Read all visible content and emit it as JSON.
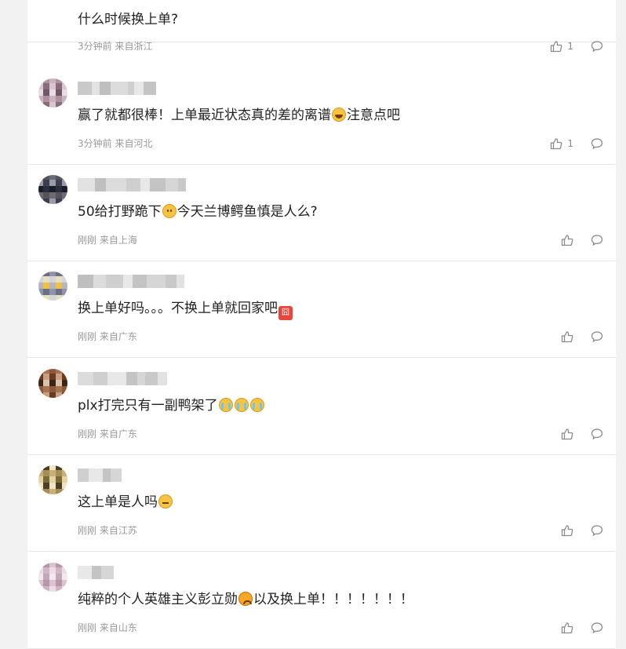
{
  "comments": [
    {
      "text": "什么时候换上单?",
      "emoji_after": [],
      "time": "3分钟前",
      "location": "来自浙江",
      "likes": "1",
      "avatar_colors": [
        "#ead9dc",
        "#d8b6c0",
        "#f3eaec",
        "#e5d2d6"
      ]
    },
    {
      "text": "赢了就都很棒！上单最近状态真的差的离谱",
      "emoji_after": [
        "laugh"
      ],
      "text_after": "注意点吧",
      "time": "3分钟前",
      "location": "来自河北",
      "likes": "1",
      "avatar_colors": [
        "#8a6b79",
        "#c9b3be",
        "#6f5866",
        "#d7c5cf",
        "#b08fa0",
        "#e8dde3"
      ]
    },
    {
      "text": "50给打野跪下",
      "emoji_after": [
        "face"
      ],
      "text_after": "今天兰博鳄鱼慎是人么?",
      "time": "刚刚",
      "location": "来自上海",
      "likes": "",
      "avatar_colors": [
        "#1b1e2a",
        "#3a3f52",
        "#6a6a78",
        "#2a2f40",
        "#9b9aa6",
        "#555"
      ]
    },
    {
      "text": "换上单好吗。。。不换上单就回家吧",
      "emoji_after": [
        "sticker"
      ],
      "time": "刚刚",
      "location": "来自广东",
      "likes": "",
      "avatar_colors": [
        "#6b6f82",
        "#b3b5c2",
        "#e6e0c0",
        "#8f93a8",
        "#f0c040",
        "#d3d4dc"
      ]
    },
    {
      "text": "plx打完只有一副鸭架了",
      "emoji_after": [
        "cry",
        "cry",
        "cry"
      ],
      "time": "刚刚",
      "location": "来自广东",
      "likes": "",
      "avatar_colors": [
        "#6a3b24",
        "#a77452",
        "#3d2416",
        "#c9a07f",
        "#8b5a3c",
        "#d9c2a9"
      ]
    },
    {
      "text": "这上单是人吗",
      "emoji_after": [
        "sleepy"
      ],
      "time": "刚刚",
      "location": "来自江苏",
      "likes": "",
      "avatar_colors": [
        "#7a6a3a",
        "#c8b078",
        "#4d4022",
        "#e3d2a2",
        "#a38e58",
        "#f0e4c4"
      ]
    },
    {
      "text": "纯粹的个人英雄主义彭立勋",
      "emoji_after": [
        "sad"
      ],
      "text_after": "以及换上单！！！！！！！",
      "time": "刚刚",
      "location": "来自山东",
      "likes": "",
      "avatar_colors": [
        "#d8c3cf",
        "#c2a6b6",
        "#ebdde5",
        "#b896a9",
        "#f2e8ee",
        "#cfb6c4"
      ]
    }
  ],
  "icons": {
    "like": "thumbs-up-icon",
    "reply": "comment-bubble-icon"
  },
  "colors": {
    "text": "#222222",
    "meta": "#999999",
    "icon": "#8a8a8a",
    "divider": "#e6e6e6"
  }
}
